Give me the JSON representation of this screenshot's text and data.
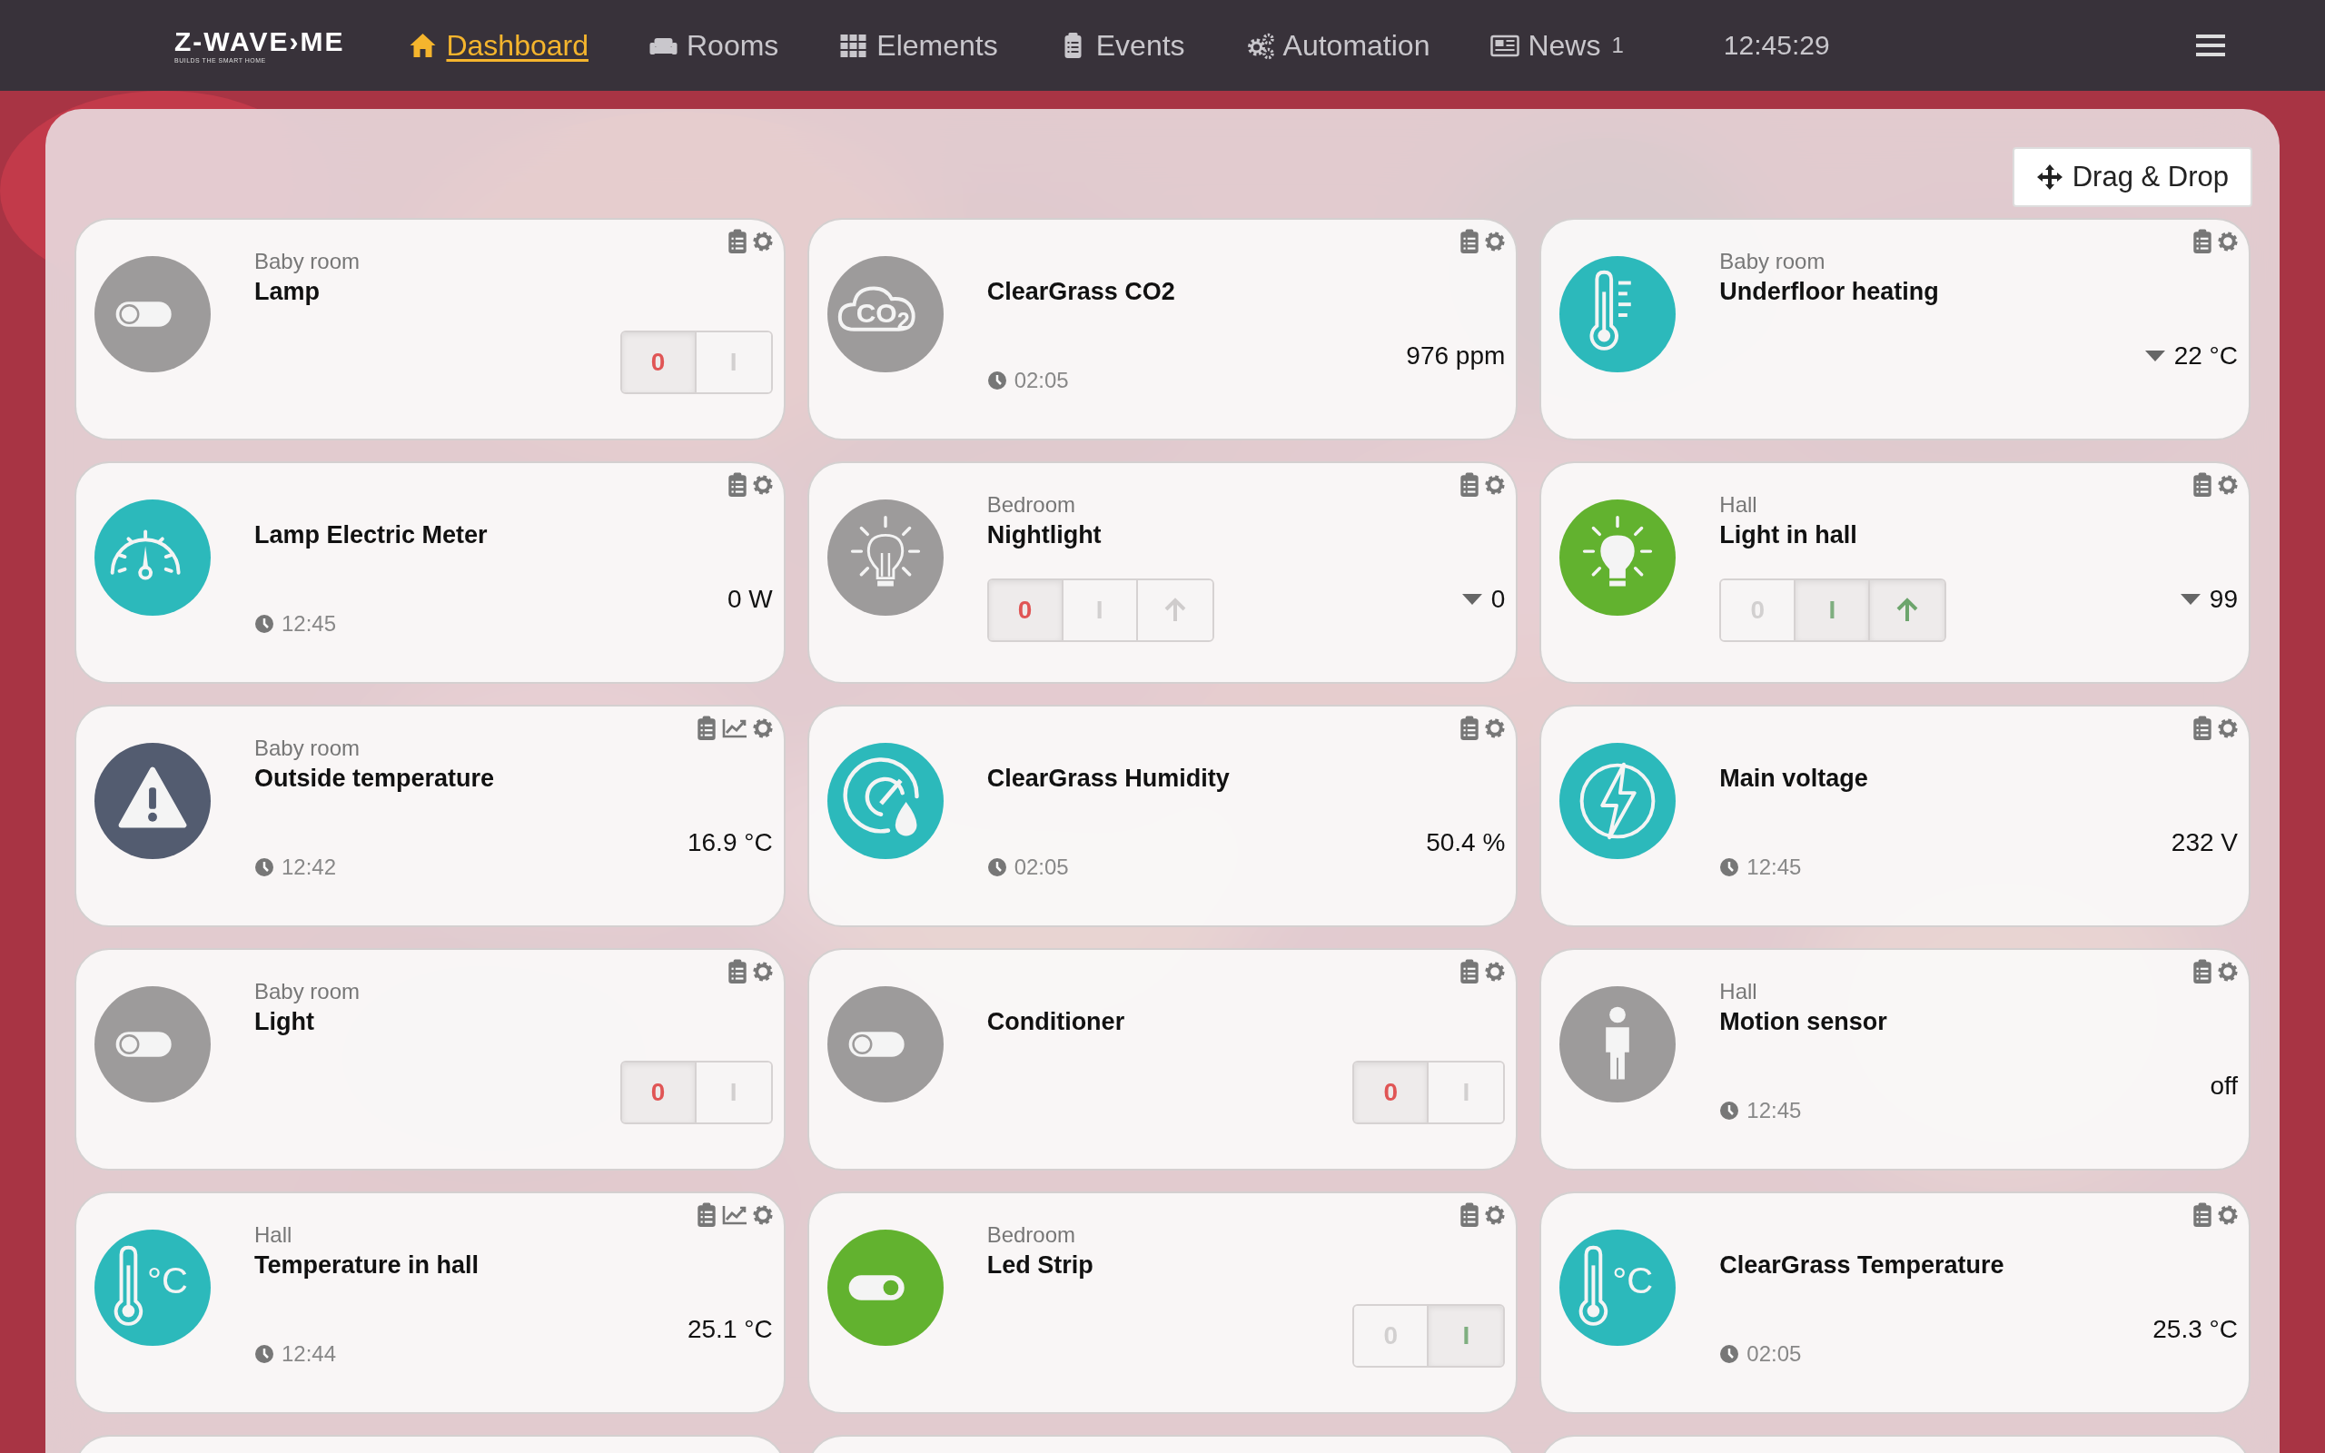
{
  "header": {
    "logo": {
      "name": "Z-WAVE›ME",
      "tagline": "BUILDS THE SMART HOME"
    },
    "nav": [
      {
        "kind": "house",
        "label": "Dashboard",
        "selected": true
      },
      {
        "kind": "sofa",
        "label": "Rooms",
        "selected": false
      },
      {
        "kind": "grid",
        "label": "Elements",
        "selected": false
      },
      {
        "kind": "clipboard",
        "label": "Events",
        "selected": false
      },
      {
        "kind": "gears",
        "label": "Automation",
        "selected": false
      },
      {
        "kind": "news",
        "label": "News",
        "badge": "1",
        "selected": false
      }
    ],
    "clock": "12:45:29"
  },
  "toolbar": {
    "button": "Drag & Drop"
  },
  "cards": [
    {
      "room": "Baby room",
      "title": "Lamp",
      "icon": {
        "kind": "toggle",
        "color": "#9d9b9b"
      },
      "control": {
        "kind": "switch",
        "on": false,
        "off_label": "0",
        "on_label": "I"
      }
    },
    {
      "title": "ClearGrass CO2",
      "icon": {
        "kind": "co2",
        "color": "#9d9b9b",
        "text": "CO$_{2}$"
      },
      "time": "02:05",
      "value": "976 ppm"
    },
    {
      "room": "Baby room",
      "title": "Underfloor heating",
      "icon": {
        "kind": "thermometer",
        "color": "#2cb9bb"
      },
      "value": "22 °C",
      "caret": true
    },
    {
      "title": "Lamp Electric Meter",
      "icon": {
        "kind": "gauge",
        "color": "#2cb9bb"
      },
      "time": "12:45",
      "value": "0 W"
    },
    {
      "room": "Bedroom",
      "title": "Nightlight",
      "icon": {
        "kind": "bulb",
        "color": "#9d9b9b"
      },
      "control": {
        "kind": "dimmer",
        "on": false,
        "off_label": "0",
        "on_label": "I"
      },
      "value": "0",
      "caret": true
    },
    {
      "room": "Hall",
      "title": "Light in hall",
      "icon": {
        "kind": "bulb",
        "color": "#62b22f"
      },
      "control": {
        "kind": "dimmer",
        "on": true,
        "off_label": "0",
        "on_label": "I"
      },
      "value": "99",
      "caret": true
    },
    {
      "room": "Baby room",
      "title": "Outside temperature",
      "icon": {
        "kind": "warning",
        "color": "#535c70"
      },
      "time": "12:42",
      "value": "16.9 °C",
      "chart": true
    },
    {
      "title": "ClearGrass Humidity",
      "icon": {
        "kind": "humidity",
        "color": "#2cb9bb"
      },
      "time": "02:05",
      "value": "50.4 %"
    },
    {
      "title": "Main voltage",
      "icon": {
        "kind": "voltage",
        "color": "#2cb9bb"
      },
      "time": "12:45",
      "value": "232 V"
    },
    {
      "room": "Baby room",
      "title": "Light",
      "icon": {
        "kind": "toggle",
        "color": "#9d9b9b"
      },
      "control": {
        "kind": "switch",
        "on": false,
        "off_label": "0",
        "on_label": "I"
      }
    },
    {
      "title": "Conditioner",
      "icon": {
        "kind": "toggle",
        "color": "#9d9b9b"
      },
      "control": {
        "kind": "switch",
        "on": false,
        "off_label": "0",
        "on_label": "I"
      }
    },
    {
      "room": "Hall",
      "title": "Motion sensor",
      "icon": {
        "kind": "person",
        "color": "#9d9b9b"
      },
      "time": "12:45",
      "value": "off"
    },
    {
      "room": "Hall",
      "title": "Temperature in hall",
      "icon": {
        "kind": "thermo-c",
        "color": "#2cb9bb",
        "text": "°C"
      },
      "time": "12:44",
      "value": "25.1 °C",
      "chart": true
    },
    {
      "room": "Bedroom",
      "title": "Led Strip",
      "icon": {
        "kind": "toggle",
        "color": "#62b22f"
      },
      "control": {
        "kind": "switch",
        "on": true,
        "off_label": "0",
        "on_label": "I"
      }
    },
    {
      "title": "ClearGrass Temperature",
      "icon": {
        "kind": "thermo-c",
        "color": "#2cb9bb",
        "text": "°C"
      },
      "time": "02:05",
      "value": "25.3 °C"
    },
    {
      "kind": "partial"
    },
    {
      "kind": "partial"
    },
    {
      "kind": "partial"
    }
  ]
}
